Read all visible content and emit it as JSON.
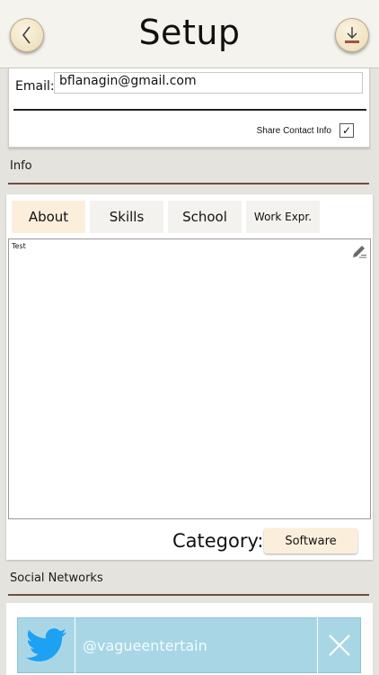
{
  "header": {
    "title": "Setup",
    "back_icon": "chevron-left-icon",
    "save_icon": "download-icon"
  },
  "contact": {
    "email_label": "Email:",
    "email_value": "bflanagin@gmail.com",
    "share_label": "Share Contact Info",
    "share_checked": true,
    "share_check_glyph": "✓"
  },
  "info": {
    "section_label": "Info",
    "tabs": [
      {
        "label": "About",
        "selected": true
      },
      {
        "label": "Skills",
        "selected": false
      },
      {
        "label": "School",
        "selected": false
      },
      {
        "label": "Work Expr.",
        "selected": false
      }
    ],
    "about_text": "Test",
    "edit_icon": "pencil-icon",
    "category_label": "Category:",
    "category_value": "Software"
  },
  "social": {
    "section_label": "Social Networks",
    "twitter_handle": "@vagueentertain",
    "twitter_icon": "twitter-bird-icon",
    "remove_icon": "close-icon"
  },
  "colors": {
    "accent_tab": "#fbefdc",
    "section_rule": "#6e4f44",
    "twitter_bg": "#a9d6e5",
    "twitter_blue": "#1da1f2"
  }
}
